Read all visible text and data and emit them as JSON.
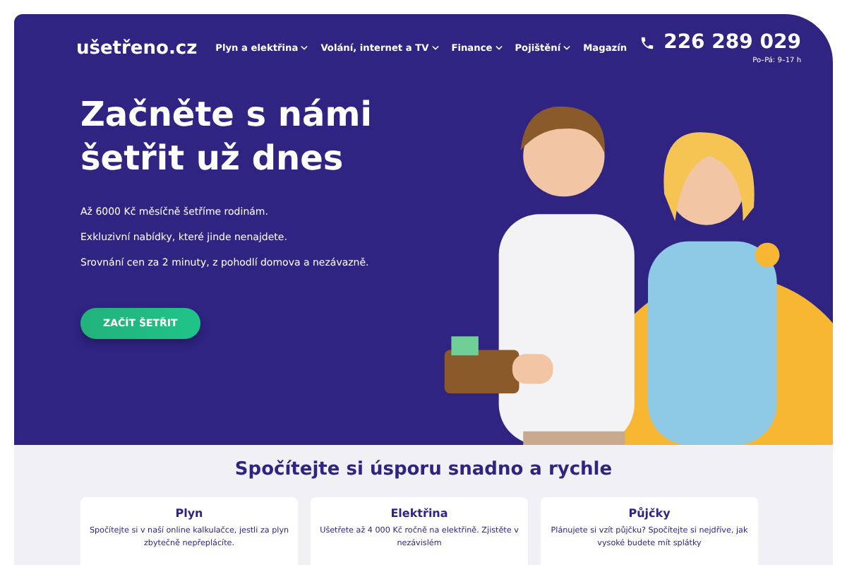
{
  "header": {
    "logo": "ušetřeno.cz",
    "nav": [
      {
        "label": "Plyn a elektřina",
        "dropdown": true
      },
      {
        "label": "Volání, internet a TV",
        "dropdown": true
      },
      {
        "label": "Finance",
        "dropdown": true
      },
      {
        "label": "Pojištění",
        "dropdown": true
      },
      {
        "label": "Magazín",
        "dropdown": false
      }
    ],
    "phone": "226 289 029",
    "hours": "Po–Pá: 9–17 h"
  },
  "hero": {
    "title": "Začněte s námi šetřit už dnes",
    "lines": [
      "Až 6000 Kč měsíčně šetříme rodinám.",
      "Exkluzivní nabídky, které jinde nenajdete.",
      "Srovnání cen za 2 minuty, z pohodlí domova a nezávazně."
    ],
    "button": "ZAČÍT ŠETŘIT"
  },
  "section": {
    "title": "Spočítejte si úsporu snadno a rychle",
    "cards": [
      {
        "title": "Plyn",
        "text": "Spočítejte si v naší online kalkulačce, jestli za plyn zbytečně nepřeplácíte."
      },
      {
        "title": "Elektřina",
        "text": "Ušetřete až 4 000 Kč ročně na elektřině. Zjistěte v nezávislém"
      },
      {
        "title": "Půjčky",
        "text": "Plánujete si vzít půjčku? Spočítejte si nejdříve, jak vysoké budete mít splátky"
      }
    ]
  }
}
